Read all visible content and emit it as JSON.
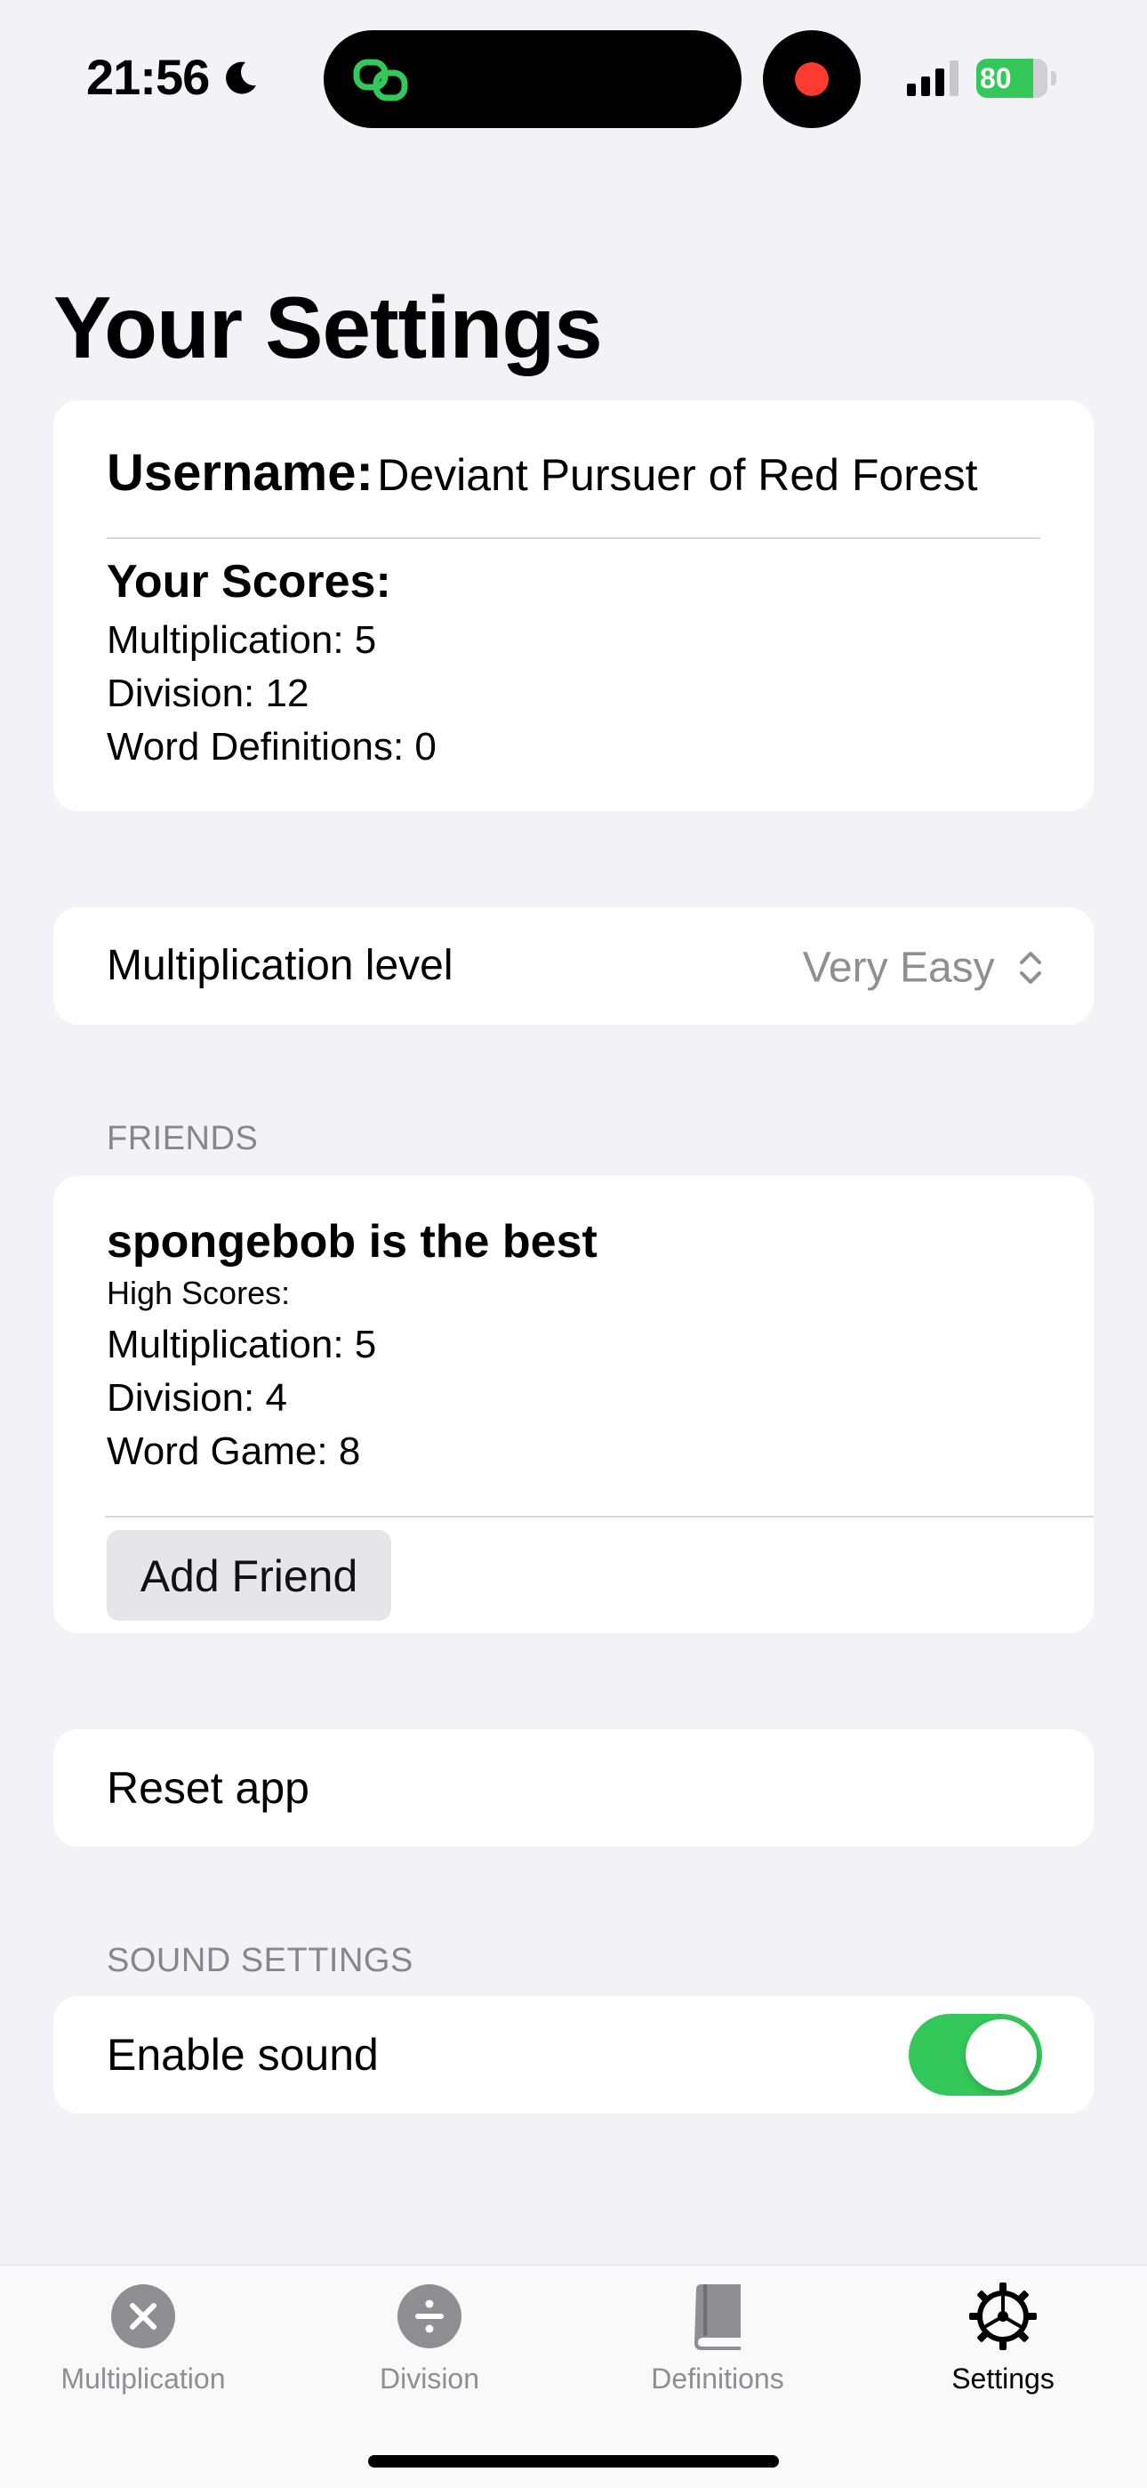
{
  "status_bar": {
    "time": "21:56",
    "battery_percent": 80,
    "battery_label": "80"
  },
  "page": {
    "title": "Your Settings"
  },
  "profile": {
    "username_label": "Username:",
    "username_value": "Deviant Pursuer of Red Forest",
    "scores_title": "Your Scores:",
    "scores": [
      "Multiplication: 5",
      "Division: 12",
      "Word Definitions: 0"
    ]
  },
  "multiplication_level": {
    "label": "Multiplication level",
    "value": "Very Easy"
  },
  "friends": {
    "header": "FRIENDS",
    "items": [
      {
        "name": "spongebob is the best",
        "subtitle": "High Scores:",
        "scores": [
          "Multiplication: 5",
          "Division: 4",
          "Word Game: 8"
        ]
      }
    ],
    "add_button": "Add Friend"
  },
  "reset": {
    "label": "Reset app"
  },
  "sound": {
    "header": "SOUND SETTINGS",
    "label": "Enable sound",
    "enabled": true
  },
  "tabbar": {
    "tabs": [
      {
        "label": "Multiplication",
        "icon": "xmark-circle-icon",
        "active": false
      },
      {
        "label": "Division",
        "icon": "divide-circle-icon",
        "active": false
      },
      {
        "label": "Definitions",
        "icon": "book-icon",
        "active": false
      },
      {
        "label": "Settings",
        "icon": "gear-icon",
        "active": true
      }
    ]
  },
  "colors": {
    "background": "#f2f2f7",
    "accent_green": "#34c759",
    "secondary_text": "#8e8e93",
    "record_red": "#ff3b30"
  }
}
